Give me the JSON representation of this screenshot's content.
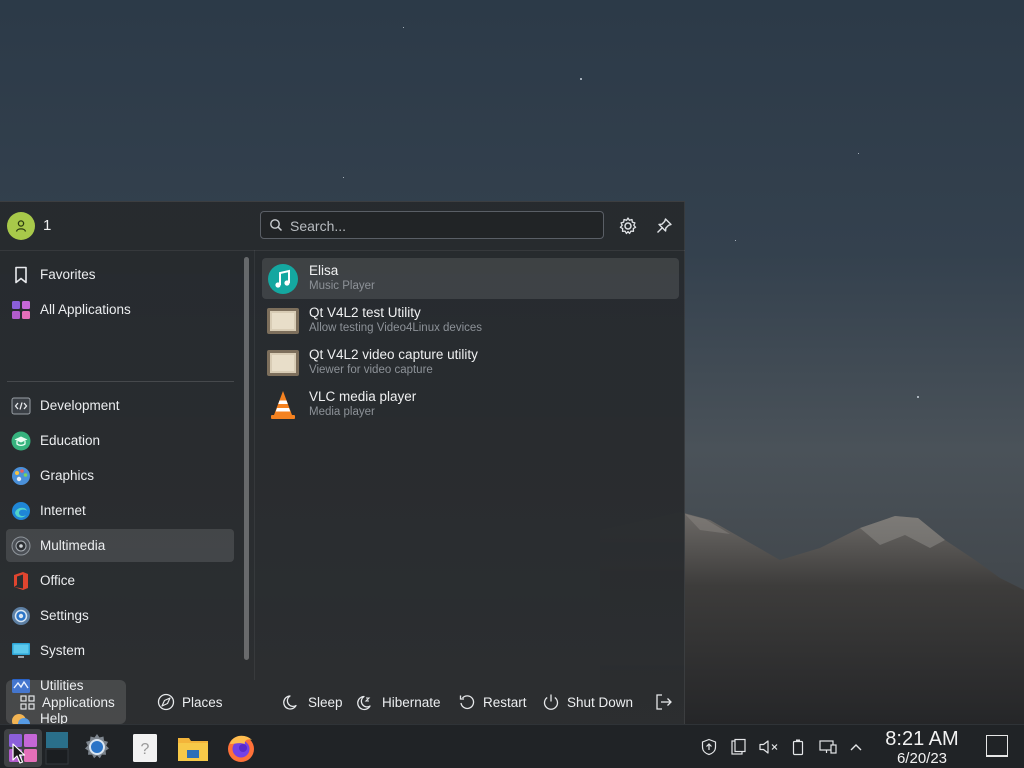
{
  "user": {
    "name": "1"
  },
  "search": {
    "placeholder": "Search..."
  },
  "categories": [
    {
      "label": "Favorites",
      "icon": "bookmark-icon"
    },
    {
      "label": "All Applications",
      "icon": "grid-apps-icon"
    },
    {
      "label": "Development",
      "icon": "code-icon"
    },
    {
      "label": "Education",
      "icon": "graduation-cap-icon"
    },
    {
      "label": "Graphics",
      "icon": "palette-icon"
    },
    {
      "label": "Internet",
      "icon": "globe-icon"
    },
    {
      "label": "Multimedia",
      "icon": "speaker-icon",
      "active": true
    },
    {
      "label": "Office",
      "icon": "office-icon"
    },
    {
      "label": "Settings",
      "icon": "settings-gear-icon"
    },
    {
      "label": "System",
      "icon": "monitor-icon"
    },
    {
      "label": "Utilities",
      "icon": "toolbox-icon"
    },
    {
      "label": "Help",
      "icon": "help-icon"
    }
  ],
  "apps": [
    {
      "name": "Elisa",
      "description": "Music Player",
      "icon": "music-note-icon"
    },
    {
      "name": "Qt V4L2 test Utility",
      "description": "Allow testing Video4Linux devices",
      "icon": "video-device-icon"
    },
    {
      "name": "Qt V4L2 video capture utility",
      "description": "Viewer for video capture",
      "icon": "video-device-icon"
    },
    {
      "name": "VLC media player",
      "description": "Media player",
      "icon": "vlc-cone-icon"
    }
  ],
  "footer": {
    "tabs": [
      {
        "label": "Applications",
        "active": true
      },
      {
        "label": "Places"
      }
    ],
    "power": [
      {
        "label": "Sleep"
      },
      {
        "label": "Hibernate"
      },
      {
        "label": "Restart"
      },
      {
        "label": "Shut Down"
      }
    ]
  },
  "taskbar": {
    "items": [
      "app-launcher-icon",
      "pager-icon",
      "system-settings-icon",
      "help-center-icon",
      "file-manager-icon",
      "firefox-icon"
    ],
    "tray": [
      "updates-icon",
      "clipboard-icon",
      "volume-muted-icon",
      "battery-icon",
      "network-icon",
      "tray-expand-icon"
    ]
  },
  "clock": {
    "time": "8:21 AM",
    "date": "6/20/23"
  },
  "colors": {
    "accent_avatar": "#a8c94a",
    "panel_bg": "#202326",
    "launcher_bg": "#26292d"
  }
}
